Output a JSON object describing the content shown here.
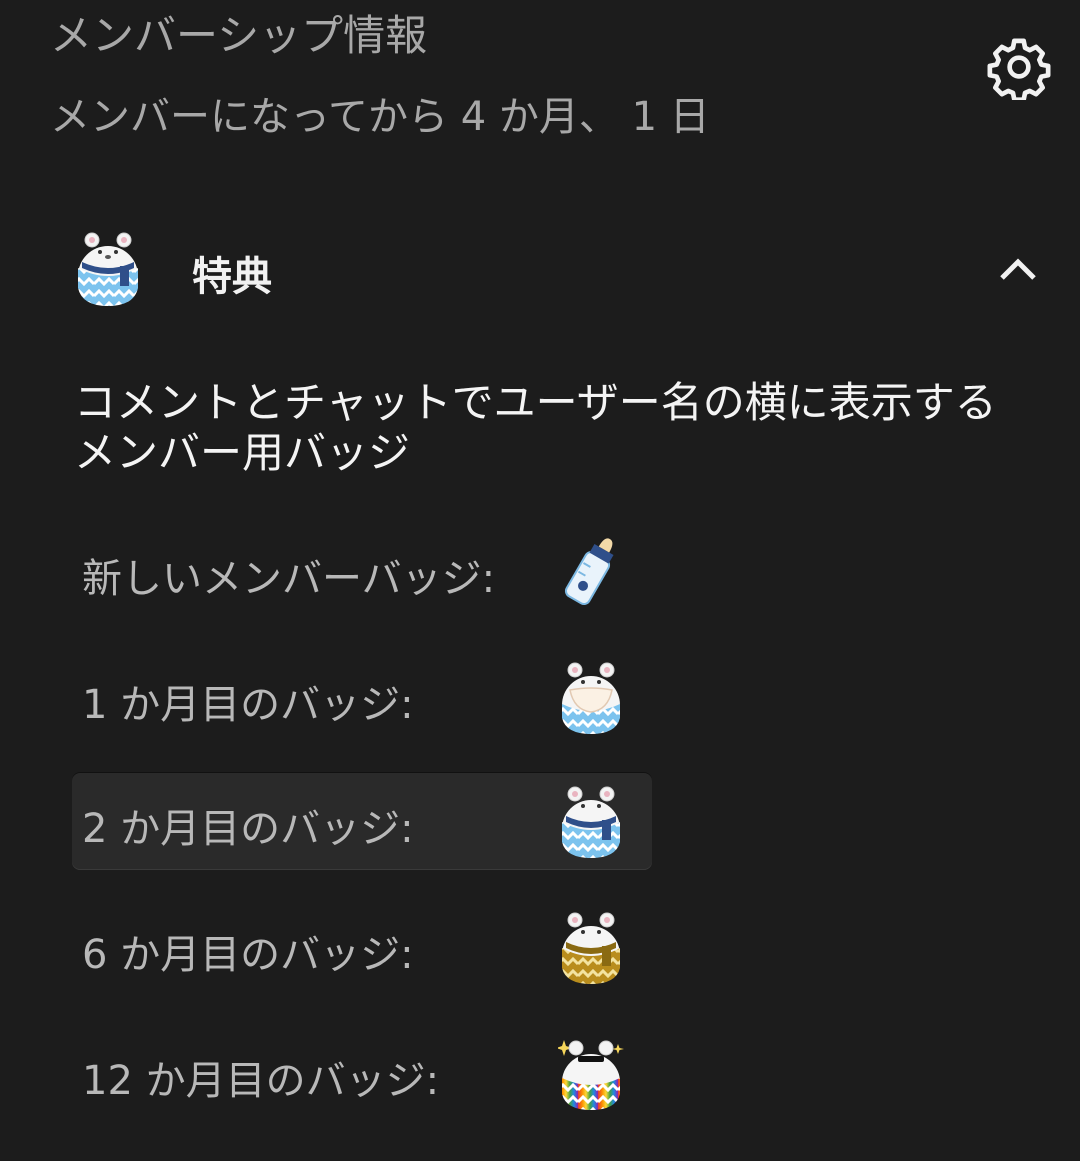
{
  "header": {
    "title": "メンバーシップ情報",
    "member_since": "メンバーになってから 4 か月、 1 日",
    "settings_icon": "gear-icon"
  },
  "perks": {
    "label": "特典",
    "expanded": true,
    "description": "コメントとチャットでユーザー名の横に表示するメンバー用バッジ"
  },
  "badges": [
    {
      "label": "新しいメンバーバッジ:",
      "icon": "baby-bottle-badge-icon",
      "selected": false
    },
    {
      "label": "1 か月目のバッジ:",
      "icon": "bear-bib-badge-icon",
      "selected": false
    },
    {
      "label": "2 か月目のバッジ:",
      "icon": "bear-blue-scarf-badge-icon",
      "selected": true
    },
    {
      "label": "6 か月目のバッジ:",
      "icon": "bear-gold-badge-icon",
      "selected": false
    },
    {
      "label": "12 か月目のバッジ:",
      "icon": "bear-rainbow-badge-icon",
      "selected": false
    }
  ],
  "colors": {
    "background": "#1c1c1c",
    "selected_row": "#2a2a2a",
    "primary_text": "#f1f1f1",
    "secondary_text": "#a8a8a8",
    "badge_blue": "#6fb8e8",
    "badge_gold": "#c9a227"
  }
}
